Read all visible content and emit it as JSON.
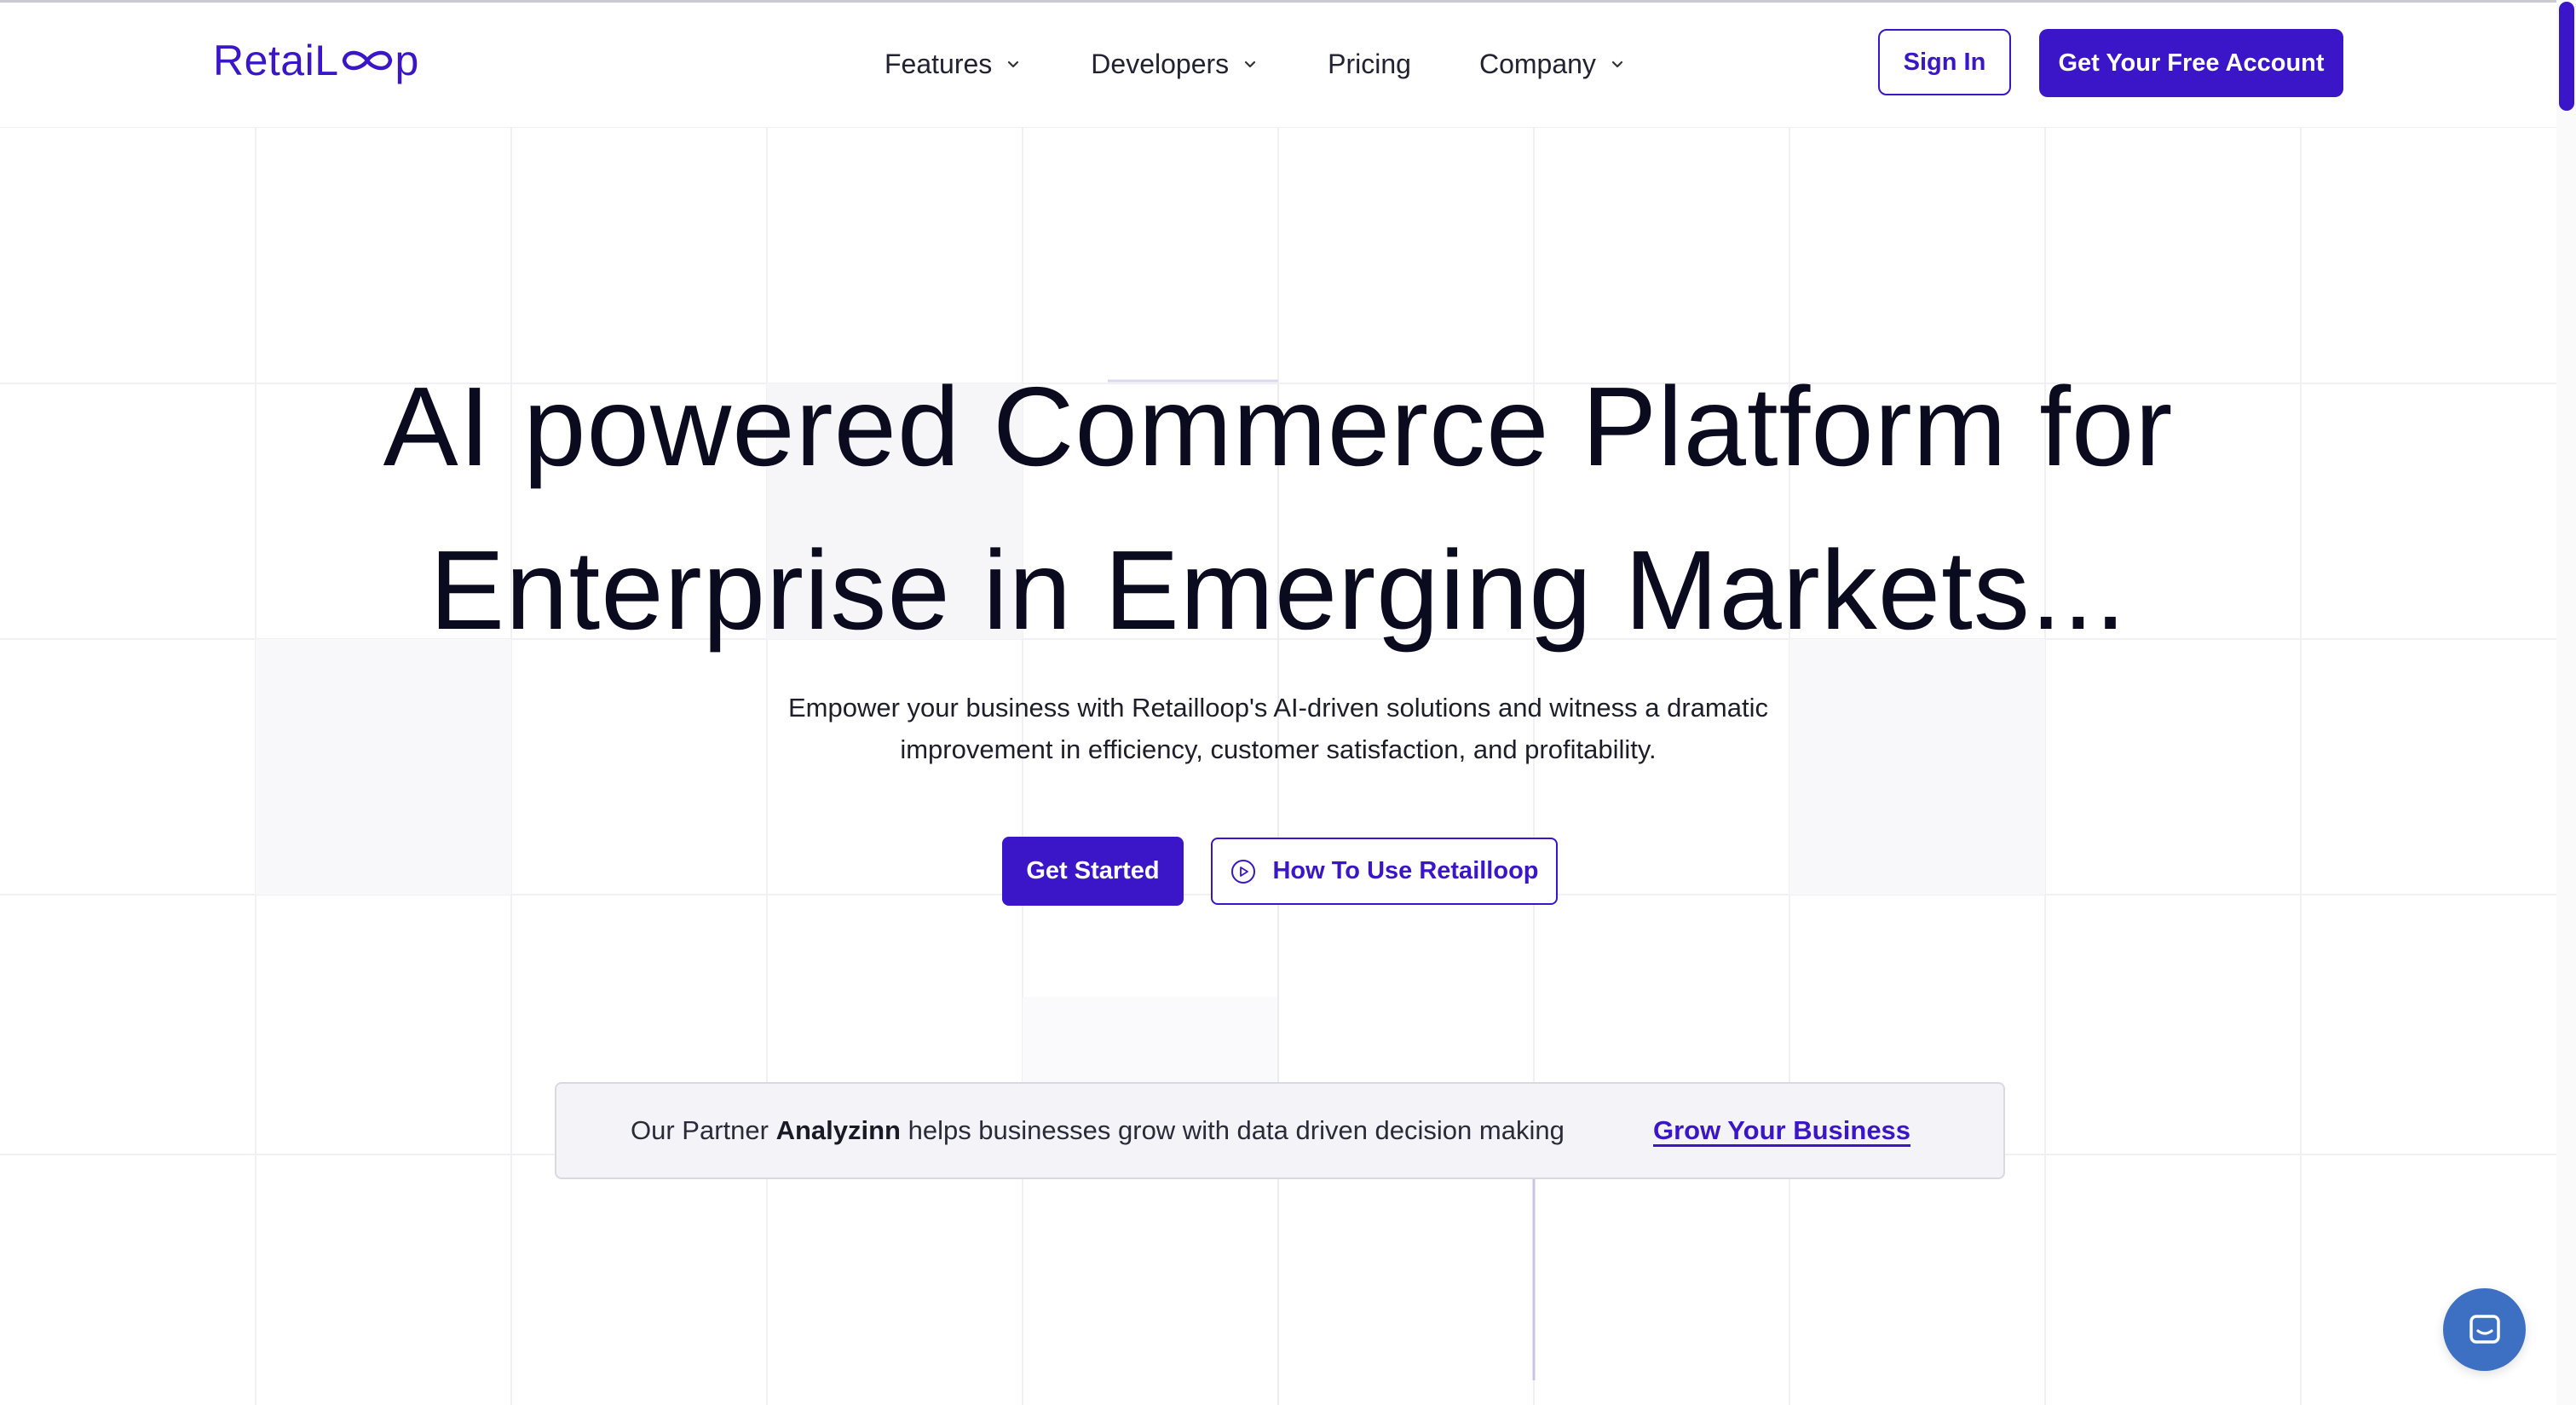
{
  "header": {
    "logo_text": "RetaiLoop",
    "logo_prefix": "RetaiL",
    "logo_suffix": "p",
    "nav": [
      {
        "label": "Features",
        "has_dropdown": true
      },
      {
        "label": "Developers",
        "has_dropdown": true
      },
      {
        "label": "Pricing",
        "has_dropdown": false
      },
      {
        "label": "Company",
        "has_dropdown": true
      }
    ],
    "signin_label": "Sign In",
    "cta_label": "Get Your Free Account"
  },
  "hero": {
    "title_line1": "AI powered Commerce Platform for",
    "title_line2": "Enterprise in Emerging Markets...",
    "subtitle_line1": "Empower your business with Retailloop's AI-driven solutions and witness a dramatic",
    "subtitle_line2": "improvement in efficiency, customer satisfaction, and profitability.",
    "primary_button": "Get Started",
    "secondary_button": "How To Use Retailloop",
    "secondary_icon": "play-circle-icon"
  },
  "partner": {
    "text_before": "Our Partner ",
    "partner_name": "Analyzinn",
    "text_after": " helps businesses grow with data driven decision making",
    "link_label": "Grow Your Business"
  },
  "chat": {
    "icon": "chat-icon"
  },
  "colors": {
    "brand": "#3b16c9",
    "chat": "#3d70c2",
    "text": "#0b0b1f",
    "banner_bg": "#f3f3f8"
  }
}
